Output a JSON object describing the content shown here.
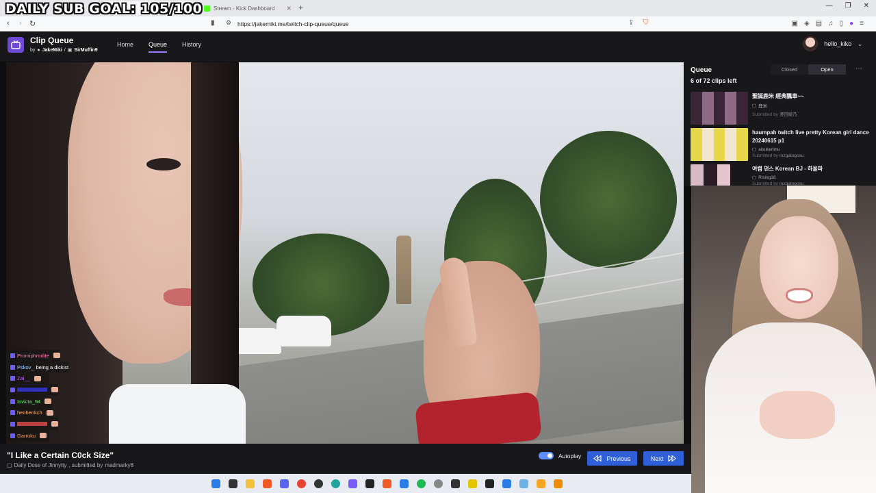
{
  "overlay": {
    "goal_text": "DAILY SUB GOAL: 105/100"
  },
  "browser": {
    "tabs": [
      {
        "title": "",
        "active": true
      },
      {
        "title": "Stream - Kick Dashboard",
        "active": false
      }
    ],
    "url": "https://jakemiki.me/twitch-clip-queue/queue"
  },
  "app": {
    "title": "Clip Queue",
    "by_label": "by",
    "author1": "JakeMiki",
    "separator": "/",
    "author2": "SirMuffin9",
    "nav": [
      "Home",
      "Queue",
      "History"
    ],
    "active_nav": "Queue",
    "username": "hello_kiko"
  },
  "chat": [
    {
      "name": "Promiphrodite",
      "color": "#ff7fb0",
      "message": ""
    },
    {
      "name": "Pskov_",
      "color": "#9fd3ff",
      "message": "being a dickist"
    },
    {
      "name": "Zai__",
      "color": "#c65bff",
      "message": ""
    },
    {
      "name": "",
      "color": "#3a3aff",
      "message": ""
    },
    {
      "name": "Invicta_94",
      "color": "#59ff59",
      "message": ""
    },
    {
      "name": "henhenkch",
      "color": "#ffb36b",
      "message": ""
    },
    {
      "name": "",
      "color": "#ff5555",
      "message": ""
    },
    {
      "name": "Garruku",
      "color": "#ff9955",
      "message": ""
    }
  ],
  "current_clip": {
    "title": "\"I Like a Certain C0ck Size\"",
    "channel": "Daily Dose of Jinnytty",
    "submitted_by_label": ", submitted by",
    "submitter": "madmarky8"
  },
  "controls": {
    "autoplay_label": "Autoplay",
    "autoplay_on": true,
    "previous_label": "Previous",
    "next_label": "Next"
  },
  "queue": {
    "title": "Queue",
    "toggle_options": [
      "Closed",
      "Open"
    ],
    "active_option": "Open",
    "count_text": "6 of 72 clips left",
    "items": [
      {
        "title": "聖誕鹿米 經典飄車~~",
        "channel": "鹿米",
        "submitted_label": "Submitted by",
        "submitter": "澄田綾乃",
        "thumb_colors": [
          "#3a2636",
          "#8e6a86",
          "#3a2636",
          "#8e6a86",
          "#3a2636"
        ]
      },
      {
        "title": "haumpah twitch live pretty Korean girl dance 20240615 p1",
        "channel": "aisukerimu",
        "submitted_label": "Submitted by",
        "submitter": "ruzgatogosu",
        "thumb_colors": [
          "#e7d84a",
          "#f2e7ce",
          "#e7d84a",
          "#f2e7ce",
          "#e7d84a"
        ]
      },
      {
        "title": "여캠 댄스 Korean BJ - 하울파",
        "channel": "Rising18",
        "submitted_label": "Submitted by",
        "submitter": "ruzgatogosu",
        "thumb_colors": [
          "#d9b9c3",
          "#2a1d25",
          "#e3c3cc"
        ]
      }
    ]
  },
  "colors": {
    "accent": "#6d49d6",
    "button_blue": "#2f5fd9",
    "header_bg": "#18181b"
  }
}
